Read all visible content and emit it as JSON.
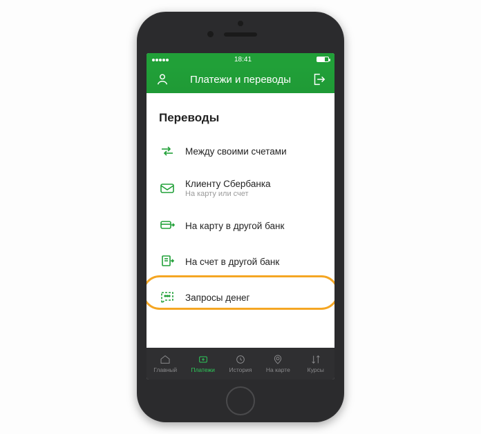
{
  "status": {
    "time": "18:41"
  },
  "header": {
    "title": "Платежи и переводы"
  },
  "section": {
    "title": "Переводы"
  },
  "items": [
    {
      "label": "Между своими счетами",
      "sub": ""
    },
    {
      "label": "Клиенту Сбербанка",
      "sub": "На карту или счет"
    },
    {
      "label": "На карту в другой банк",
      "sub": ""
    },
    {
      "label": "На счет в другой банк",
      "sub": ""
    },
    {
      "label": "Запросы денег",
      "sub": ""
    }
  ],
  "tabs": [
    {
      "label": "Главный"
    },
    {
      "label": "Платежи"
    },
    {
      "label": "История"
    },
    {
      "label": "На карте"
    },
    {
      "label": "Курсы"
    }
  ],
  "colors": {
    "accent": "#21a038",
    "highlight": "#f5a623"
  }
}
